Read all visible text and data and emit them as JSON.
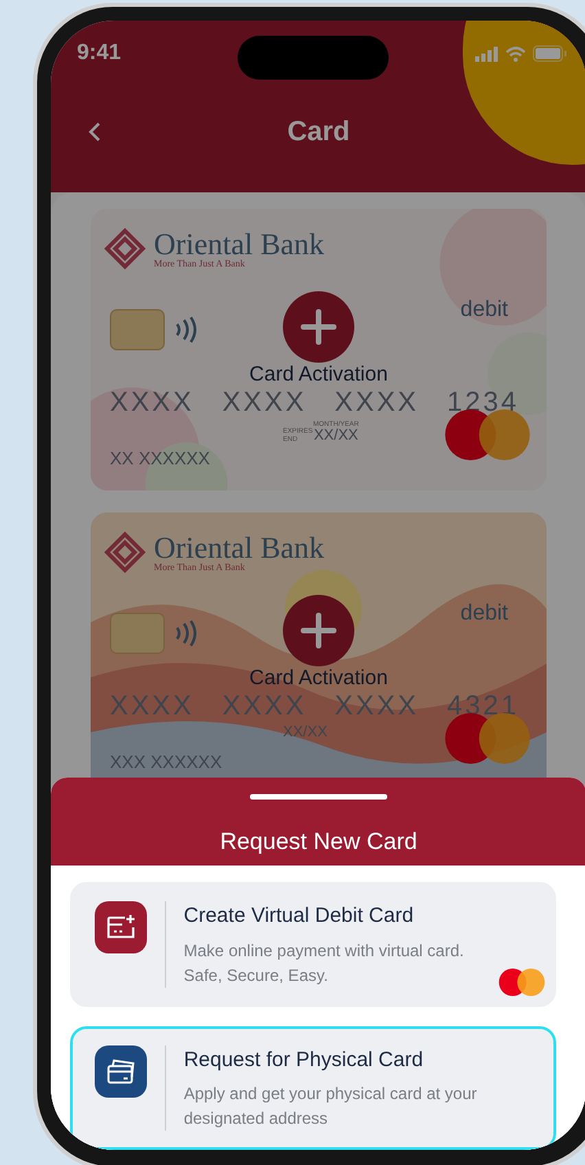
{
  "status_bar": {
    "time": "9:41"
  },
  "header": {
    "title": "Card"
  },
  "backdrop_dimmed": true,
  "cards": [
    {
      "kind": "floral",
      "bank_name": "Oriental Bank",
      "tagline": "More Than Just A Bank",
      "type_label": "debit",
      "number_groups": [
        "XXXX",
        "XXXX",
        "XXXX",
        "1234"
      ],
      "expiry_caption": "MONTH/YEAR",
      "expiry_label": "EXPIRES END",
      "expiry": "XX/XX",
      "holder": "XX XXXXXX",
      "action": "Card Activation"
    },
    {
      "kind": "mountain",
      "bank_name": "Oriental Bank",
      "tagline": "More Than Just A Bank",
      "type_label": "debit",
      "number_groups": [
        "XXXX",
        "XXXX",
        "XXXX",
        "4321"
      ],
      "expiry": "XX/XX",
      "holder": "XXX XXXXXX",
      "action": "Card Activation"
    }
  ],
  "sheet": {
    "title": "Request New Card",
    "options": [
      {
        "kind": "virtual",
        "title": "Create Virtual Debit Card",
        "description": "Make online payment with virtual card. Safe, Secure, Easy.",
        "mastercard": true,
        "selected": false
      },
      {
        "kind": "physical",
        "title": "Request for Physical Card",
        "description": "Apply and get your physical card at your designated address",
        "mastercard": false,
        "selected": true
      }
    ]
  }
}
